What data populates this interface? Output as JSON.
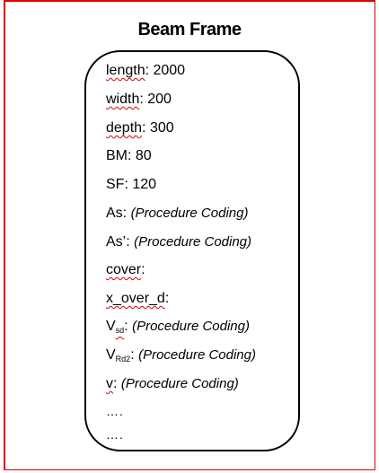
{
  "title": "Beam Frame",
  "border_color": "#e00000",
  "fields": [
    {
      "name": "length",
      "value": "2000"
    },
    {
      "name": "width",
      "value": "200"
    },
    {
      "name": "depth",
      "value": "300"
    },
    {
      "name": "BM",
      "value": "80"
    },
    {
      "name": "SF",
      "value": "120"
    },
    {
      "name": "As",
      "value": "(Procedure Coding)"
    },
    {
      "name": "As’",
      "value": "(Procedure Coding)"
    },
    {
      "name": "cover",
      "value": ""
    },
    {
      "name": "x_over_d",
      "value": ""
    },
    {
      "name": "V",
      "subscript": "sd",
      "value": "(Procedure Coding)"
    },
    {
      "name": "V",
      "subscript": "Rd2",
      "value": "(Procedure Coding)"
    },
    {
      "name": "v",
      "value": "(Procedure Coding)"
    }
  ],
  "ellipsis": [
    "….",
    "…."
  ]
}
